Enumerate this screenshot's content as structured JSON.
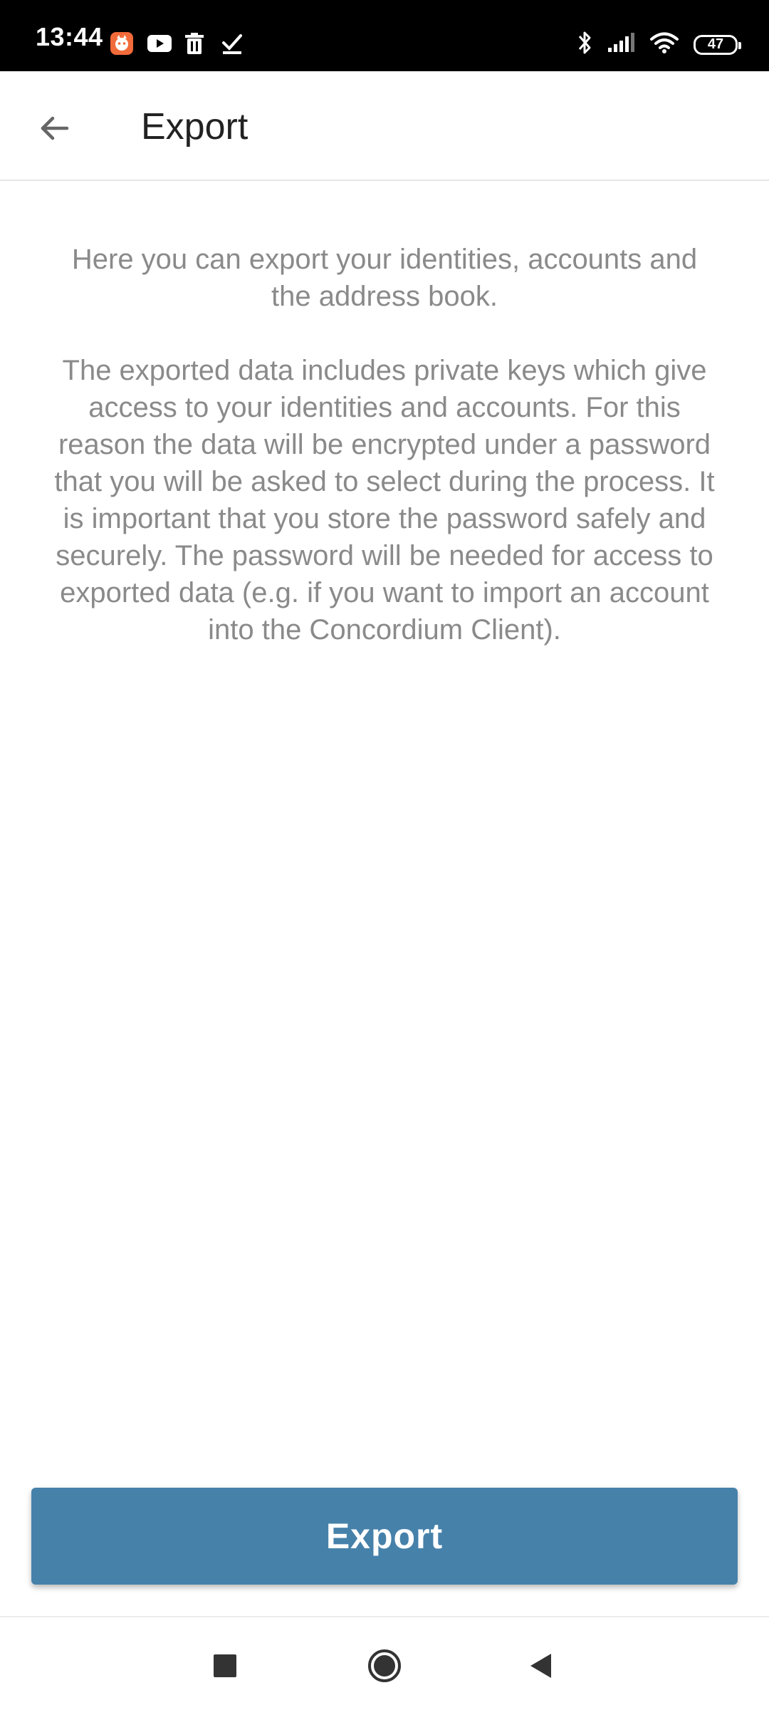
{
  "status_bar": {
    "time": "13:44",
    "battery_level": "47",
    "left_icons": [
      "app-notification-icon",
      "youtube-icon",
      "trash-icon",
      "check-icon"
    ],
    "right_icons": [
      "bluetooth-icon",
      "signal-icon",
      "wifi-icon",
      "battery-icon"
    ]
  },
  "app_bar": {
    "title": "Export",
    "back_icon": "arrow-left-icon"
  },
  "content": {
    "intro": "Here you can export your identities, accounts and the address book.",
    "details": "The exported data includes private keys which give access to your identities and accounts. For this reason the data will be encrypted under a password that you will be asked to select during the process. It is important that you store the password safely and securely. The password will be needed for access to exported data (e.g. if you want to import an account into the Concordium Client)."
  },
  "actions": {
    "export_label": "Export"
  },
  "nav_bar": {
    "icons": [
      "recent-apps-icon",
      "home-icon",
      "back-icon"
    ]
  },
  "colors": {
    "primary": "#4681aa",
    "text_muted": "#8a8a8a",
    "status_bar": "#000000"
  }
}
